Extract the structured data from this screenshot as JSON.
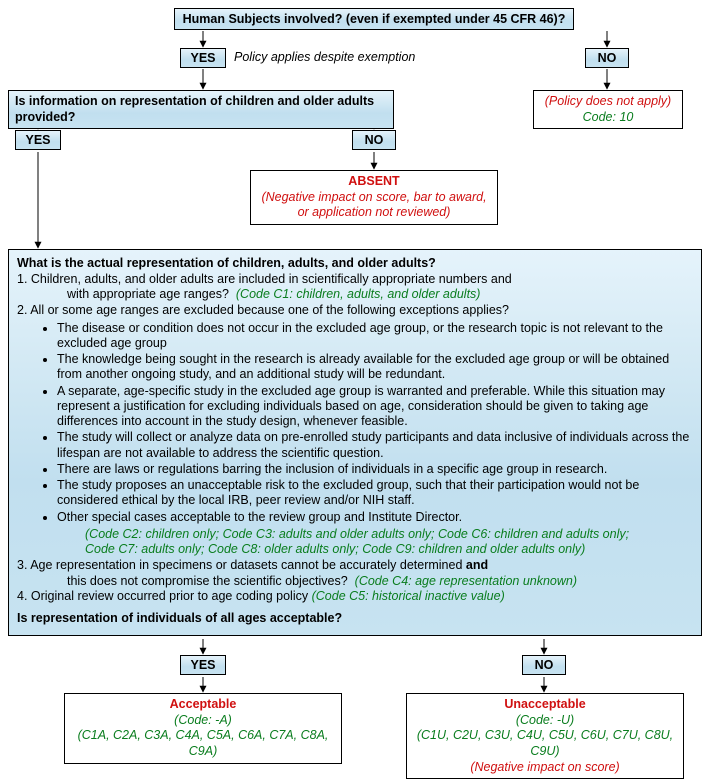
{
  "q1": "Human Subjects involved? (even if exempted under 45 CFR 46)?",
  "yes": "YES",
  "no": "NO",
  "note_exempt": "Policy applies despite exemption",
  "not_apply": "(Policy does not apply)",
  "code10": "Code: 10",
  "q2": "Is information on representation of children and older adults provided?",
  "absent": "ABSENT",
  "absent_detail": "(Negative impact on score, bar to award, or application not reviewed)",
  "big_title": "What is the actual representation of children, adults, and older adults?",
  "p1a": "1. Children, adults, and older adults are included in scientifically appropriate numbers and",
  "p1b": "with appropriate age ranges?",
  "p1code": "(Code C1: children, adults, and older adults)",
  "p2a": "2. All or some age ranges are excluded because one of the following exceptions applies?",
  "b1": "The disease or condition does not occur in the excluded age group, or the research topic is not relevant to the excluded age group",
  "b2": "The knowledge being sought in the research is already available for the excluded age group or will be obtained from another ongoing study, and an additional study will be redundant.",
  "b3": "A separate, age-specific study in the excluded age group is warranted and preferable. While this situation may represent a justification for excluding individuals based on age, consideration should be given to taking age differences into account in the study design, whenever feasible.",
  "b4": "The study will collect or analyze data on pre-enrolled study participants and data inclusive of individuals across the lifespan are not available to address the scientific question.",
  "b5": "There are laws or regulations barring the inclusion of individuals in a specific age group in research.",
  "b6": "The study proposes an unacceptable risk to the excluded group, such that their participation would not be considered ethical by the local IRB, peer review and/or NIH staff.",
  "b7": "Other special cases acceptable to the review group and Institute Director.",
  "p2code1": "(Code C2: children only; Code C3: adults and older adults only; Code C6: children and adults only;",
  "p2code2": "Code C7: adults only; Code C8: older adults only; Code C9: children and older adults only)",
  "p3a": "3. Age representation in specimens or datasets cannot be accurately determined",
  "p3and": "and",
  "p3b": "this does not compromise the scientific objectives?",
  "p3code": "(Code C4: age representation unknown)",
  "p4": "4. Original review occurred prior to age coding policy",
  "p4code": "(Code C5: historical inactive value)",
  "q3": "Is representation of individuals of all ages acceptable?",
  "acceptable": "Acceptable",
  "acc_code": "(Code: -A)",
  "acc_list": "(C1A, C2A, C3A, C4A, C5A, C6A, C7A, C8A, C9A)",
  "unacceptable": "Unacceptable",
  "un_code": "(Code: -U)",
  "un_list": "(C1U, C2U, C3U, C4U, C5U, C6U, C7U, C8U, C9U)",
  "un_neg": "(Negative impact on score)"
}
